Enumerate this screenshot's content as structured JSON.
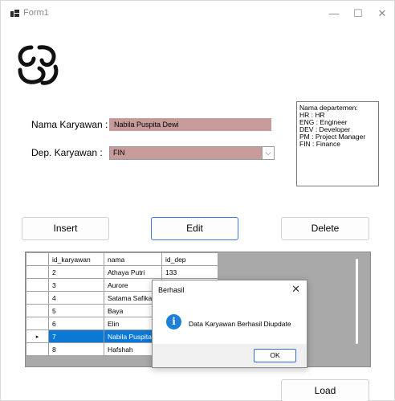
{
  "window": {
    "title": "Form1",
    "minimize": "—",
    "maximize": "☐",
    "close": "✕"
  },
  "form": {
    "nama_label": "Nama Karyawan :",
    "nama_value": "Nabila Puspita Dewi",
    "dep_label": "Dep. Karyawan :",
    "dep_value": "FIN",
    "dep_arrow": "⌵"
  },
  "legend": {
    "lines": [
      "Nama departemen:",
      "HR : HR",
      "ENG : Engineer",
      "DEV : Developer",
      "PM : Project Manager",
      "FIN : Finance"
    ]
  },
  "buttons": {
    "insert": "Insert",
    "edit": "Edit",
    "delete": "Delete",
    "load": "Load"
  },
  "grid": {
    "columns": [
      "id_karyawan",
      "nama",
      "id_dep"
    ],
    "rows": [
      {
        "id": "2",
        "nama": "Athaya Putri",
        "dep": "133"
      },
      {
        "id": "3",
        "nama": "Aurore",
        "dep": ""
      },
      {
        "id": "4",
        "nama": "Satama Safika",
        "dep": ""
      },
      {
        "id": "5",
        "nama": "Baya",
        "dep": ""
      },
      {
        "id": "6",
        "nama": "Elin",
        "dep": ""
      },
      {
        "id": "7",
        "nama": "Nabila Puspita",
        "dep": ""
      },
      {
        "id": "8",
        "nama": "Hafshah",
        "dep": ""
      }
    ],
    "current_row_marker": "▸"
  },
  "dialog": {
    "title": "Berhasil",
    "close": "✕",
    "icon": "info-icon",
    "icon_glyph": "i",
    "message": "Data Karyawan Berhasil Diupdate",
    "ok": "OK"
  },
  "colors": {
    "input_bg": "#c89b9b",
    "selection": "#0b78d6",
    "grid_bg": "#a9a9a9",
    "focus_border": "#3b78d8"
  }
}
